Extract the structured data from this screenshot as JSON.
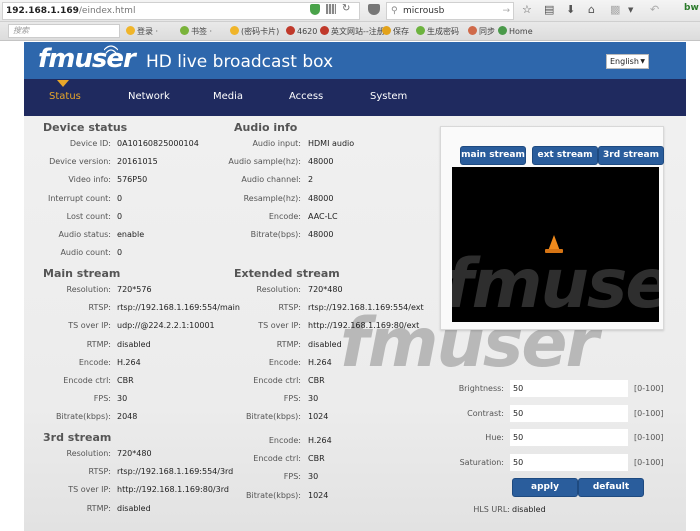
{
  "browser": {
    "url_host": "192.168.1.169",
    "url_path": "/eindex.html",
    "search_value": "microusb",
    "search_placeholder": "搜索",
    "bookmarks": [
      {
        "label": "登录 ·",
        "color": "#f0b52a"
      },
      {
        "label": "书签 ·",
        "color": "#7ab33a"
      },
      {
        "label": "(密码卡片)",
        "color": "#f0b52a"
      },
      {
        "label": "4620",
        "color": "#c0392b"
      },
      {
        "label": "英文网站--注册",
        "color": "#c0392b"
      },
      {
        "label": "保存",
        "color": "#e2a21a"
      },
      {
        "label": "生成密码",
        "color": "#6db33f"
      },
      {
        "label": "同步",
        "color": "#d06a4a"
      },
      {
        "label": "Home",
        "color": "#4a9a4a"
      }
    ]
  },
  "header": {
    "logo": "fmuser",
    "title": "HD live broadcast box",
    "language": "English"
  },
  "nav": {
    "items": [
      "Status",
      "Network",
      "Media",
      "Access",
      "System"
    ],
    "active": "Status"
  },
  "device_status": {
    "title": "Device status",
    "rows": [
      {
        "label": "Device ID:",
        "value": "0A10160825000104"
      },
      {
        "label": "Device version:",
        "value": "20161015"
      },
      {
        "label": "Video info:",
        "value": "576P50"
      },
      {
        "label": "Interrupt count:",
        "value": "0"
      },
      {
        "label": "Lost count:",
        "value": "0"
      },
      {
        "label": "Audio status:",
        "value": "enable"
      },
      {
        "label": "Audio count:",
        "value": "0"
      }
    ]
  },
  "audio_info": {
    "title": "Audio info",
    "rows": [
      {
        "label": "Audio input:",
        "value": "HDMI audio"
      },
      {
        "label": "Audio sample(hz):",
        "value": "48000"
      },
      {
        "label": "Audio channel:",
        "value": "2"
      },
      {
        "label": "Resample(hz):",
        "value": "48000"
      },
      {
        "label": "Encode:",
        "value": "AAC-LC"
      },
      {
        "label": "Bitrate(bps):",
        "value": "48000"
      }
    ]
  },
  "main_stream": {
    "title": "Main stream",
    "rows": [
      {
        "label": "Resolution:",
        "value": "720*576"
      },
      {
        "label": "RTSP:",
        "value": "rtsp://192.168.1.169:554/main"
      },
      {
        "label": "TS over IP:",
        "value": "udp://@224.2.2.1:10001"
      },
      {
        "label": "RTMP:",
        "value": "disabled"
      },
      {
        "label": "Encode:",
        "value": "H.264"
      },
      {
        "label": "Encode ctrl:",
        "value": "CBR"
      },
      {
        "label": "FPS:",
        "value": "30"
      },
      {
        "label": "Bitrate(kbps):",
        "value": "2048"
      }
    ]
  },
  "extended_stream": {
    "title": "Extended stream",
    "rows": [
      {
        "label": "Resolution:",
        "value": "720*480"
      },
      {
        "label": "RTSP:",
        "value": "rtsp://192.168.1.169:554/ext"
      },
      {
        "label": "TS over IP:",
        "value": "http://192.168.1.169:80/ext"
      },
      {
        "label": "RTMP:",
        "value": "disabled"
      },
      {
        "label": "Encode:",
        "value": "H.264"
      },
      {
        "label": "Encode ctrl:",
        "value": "CBR"
      },
      {
        "label": "FPS:",
        "value": "30"
      },
      {
        "label": "Bitrate(kbps):",
        "value": "1024"
      }
    ]
  },
  "third_stream": {
    "title": "3rd stream",
    "rows_left": [
      {
        "label": "Resolution:",
        "value": "720*480"
      },
      {
        "label": "RTSP:",
        "value": "rtsp://192.168.1.169:554/3rd"
      },
      {
        "label": "TS over IP:",
        "value": "http://192.168.1.169:80/3rd"
      },
      {
        "label": "RTMP:",
        "value": "disabled"
      }
    ],
    "rows_right": [
      {
        "label": "Encode:",
        "value": "H.264"
      },
      {
        "label": "Encode ctrl:",
        "value": "CBR"
      },
      {
        "label": "FPS:",
        "value": "30"
      },
      {
        "label": "Bitrate(kbps):",
        "value": "1024"
      }
    ]
  },
  "player": {
    "buttons": [
      "main stream",
      "ext stream",
      "3rd stream"
    ],
    "watermark": "fmuser"
  },
  "adjustments": {
    "rows": [
      {
        "label": "Brightness:",
        "value": "50",
        "range": "[0-100]"
      },
      {
        "label": "Contrast:",
        "value": "50",
        "range": "[0-100]"
      },
      {
        "label": "Hue:",
        "value": "50",
        "range": "[0-100]"
      },
      {
        "label": "Saturation:",
        "value": "50",
        "range": "[0-100]"
      }
    ],
    "apply_label": "apply",
    "default_label": "default",
    "hls_label": "HLS URL:",
    "hls_value": "disabled"
  },
  "colors": {
    "header_blue": "#2e67ac",
    "nav_navy": "#1f2a5f",
    "active_orange": "#e6a52a",
    "button_blue": "#2a5d9c"
  }
}
